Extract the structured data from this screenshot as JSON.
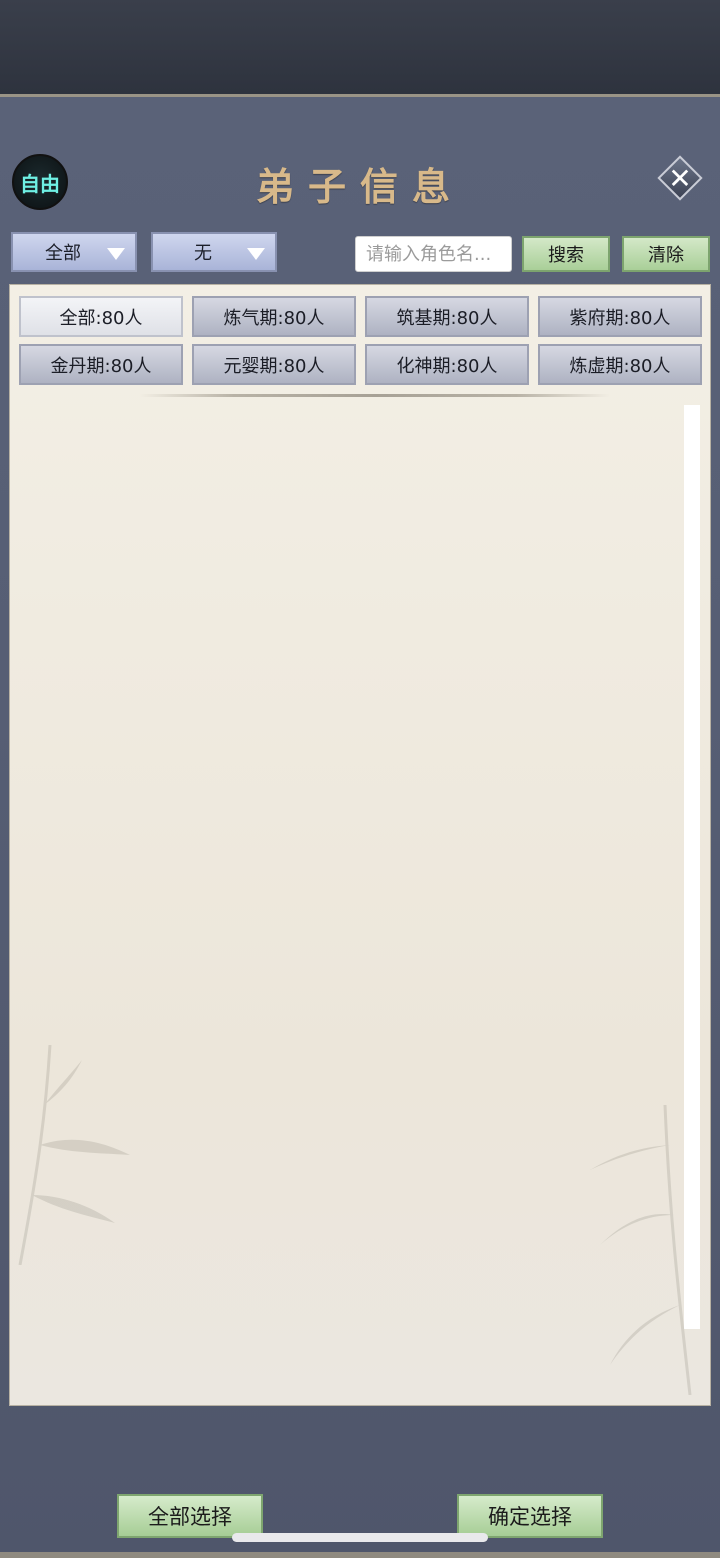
{
  "header": {
    "mode_badge": "自由",
    "title": "弟子信息",
    "close_icon": "close-icon"
  },
  "filters": {
    "dropdown_1": "全部",
    "dropdown_2": "无",
    "search_placeholder": "请输入角色名...",
    "search_button": "搜索",
    "clear_button": "清除"
  },
  "tabs": [
    {
      "label": "全部:80人",
      "active": true
    },
    {
      "label": "炼气期:80人"
    },
    {
      "label": "筑基期:80人"
    },
    {
      "label": "紫府期:80人"
    },
    {
      "label": "金丹期:80人"
    },
    {
      "label": "元婴期:80人"
    },
    {
      "label": "化神期:80人"
    },
    {
      "label": "炼虚期:80人"
    }
  ],
  "footer": {
    "select_all": "全部选择",
    "confirm": "确定选择"
  },
  "colors": {
    "title": "#d8b98a",
    "badge_text": "#6ff0e4",
    "panel": "#565e74",
    "button_green": "#a9cf98"
  }
}
